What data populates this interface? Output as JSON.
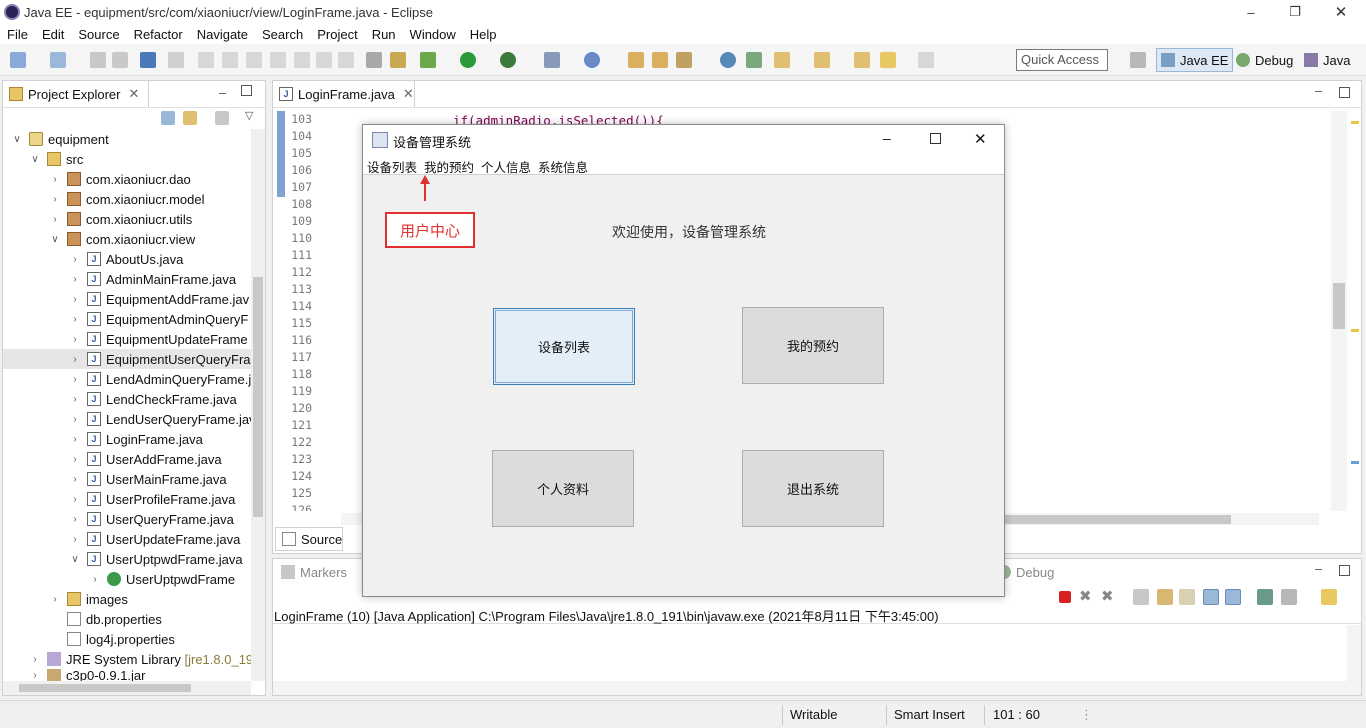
{
  "window": {
    "title": "Java EE - equipment/src/com/xiaoniucr/view/LoginFrame.java - Eclipse"
  },
  "menu": [
    "File",
    "Edit",
    "Source",
    "Refactor",
    "Navigate",
    "Search",
    "Project",
    "Run",
    "Window",
    "Help"
  ],
  "quick_access": "Quick Access",
  "perspectives": [
    "Java EE",
    "Debug",
    "Java"
  ],
  "project_explorer": {
    "tab": "Project Explorer",
    "items": [
      {
        "label": "equipment",
        "icon": "project-icon"
      },
      {
        "label": "src",
        "icon": "folder-icon"
      },
      {
        "label": "com.xiaoniucr.dao",
        "icon": "package-icon"
      },
      {
        "label": "com.xiaoniucr.model",
        "icon": "package-icon"
      },
      {
        "label": "com.xiaoniucr.utils",
        "icon": "package-icon"
      },
      {
        "label": "com.xiaoniucr.view",
        "icon": "package-icon"
      },
      {
        "label": "AboutUs.java",
        "icon": "java-file-icon"
      },
      {
        "label": "AdminMainFrame.java",
        "icon": "java-file-icon"
      },
      {
        "label": "EquipmentAddFrame.jav",
        "icon": "java-file-icon"
      },
      {
        "label": "EquipmentAdminQueryF",
        "icon": "java-file-icon"
      },
      {
        "label": "EquipmentUpdateFrame",
        "icon": "java-file-icon"
      },
      {
        "label": "EquipmentUserQueryFra",
        "icon": "java-file-icon"
      },
      {
        "label": "LendAdminQueryFrame.j",
        "icon": "java-file-icon"
      },
      {
        "label": "LendCheckFrame.java",
        "icon": "java-file-icon"
      },
      {
        "label": "LendUserQueryFrame.jav",
        "icon": "java-file-icon"
      },
      {
        "label": "LoginFrame.java",
        "icon": "java-file-icon"
      },
      {
        "label": "UserAddFrame.java",
        "icon": "java-file-icon"
      },
      {
        "label": "UserMainFrame.java",
        "icon": "java-file-icon"
      },
      {
        "label": "UserProfileFrame.java",
        "icon": "java-file-icon"
      },
      {
        "label": "UserQueryFrame.java",
        "icon": "java-file-icon"
      },
      {
        "label": "UserUpdateFrame.java",
        "icon": "java-file-icon"
      },
      {
        "label": "UserUptpwdFrame.java",
        "icon": "java-file-icon"
      },
      {
        "label": "UserUptpwdFrame",
        "icon": "class-icon"
      },
      {
        "label": "images",
        "icon": "folder-icon"
      },
      {
        "label": "db.properties",
        "icon": "file-icon"
      },
      {
        "label": "log4j.properties",
        "icon": "file-icon"
      },
      {
        "label": "JRE System Library",
        "icon": "library-icon",
        "suffix": "[jre1.8.0_19"
      },
      {
        "label": "c3p0-0.9.1.jar",
        "icon": "jar-icon"
      }
    ]
  },
  "editor": {
    "tab": "LoginFrame.java",
    "code_line": "if(adminRadio.isSelected()){",
    "line_numbers": [
      "103",
      "104",
      "105",
      "106",
      "107",
      "108",
      "109",
      "110",
      "111",
      "112",
      "113",
      "114",
      "115",
      "116",
      "117",
      "118",
      "119",
      "120",
      "121",
      "122",
      "123",
      "124",
      "125",
      "126"
    ],
    "bottom_tab": "Source"
  },
  "bottom_panel": {
    "tabs": [
      "Markers",
      "Debug"
    ],
    "console_text": "LoginFrame (10) [Java Application] C:\\Program Files\\Java\\jre1.8.0_191\\bin\\javaw.exe (2021年8月11日 下午3:45:00)"
  },
  "dialog": {
    "title": "设备管理系统",
    "menu": [
      "设备列表",
      "我的预约",
      "个人信息",
      "系统信息"
    ],
    "annotation": "用户中心",
    "welcome": "欢迎使用，设备管理系统",
    "buttons": [
      "设备列表",
      "我的预约",
      "个人资料",
      "退出系统"
    ]
  },
  "status_bar": {
    "writable": "Writable",
    "insert_mode": "Smart Insert",
    "position": "101 : 60"
  },
  "colors": {
    "annotation_red": "#e03030",
    "selection_blue": "#cce4f7",
    "button_focus_bg": "#e4eef9"
  }
}
